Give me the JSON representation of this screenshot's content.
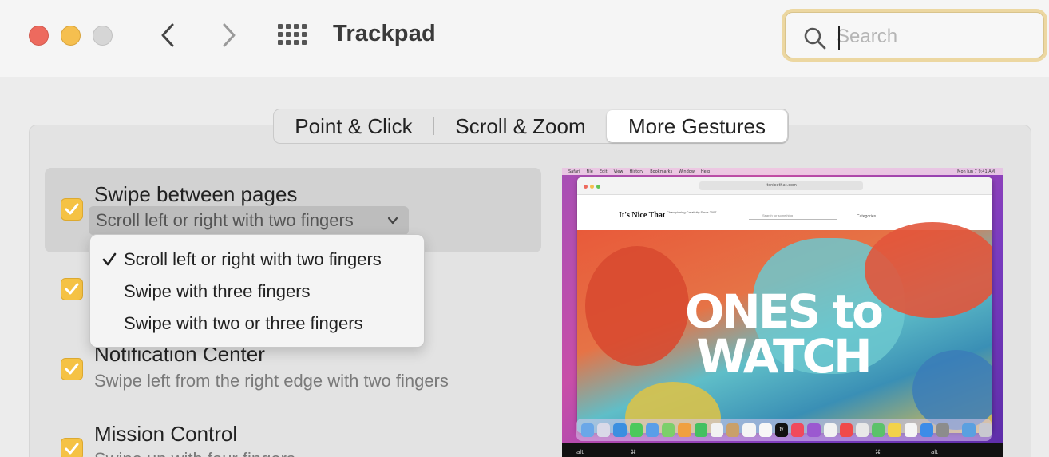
{
  "window": {
    "title": "Trackpad",
    "traffic_lights": {
      "close": "#ed6a5e",
      "minimize": "#f5bf4f",
      "zoom": "#d6d6d6"
    }
  },
  "toolbar": {
    "back_icon": "chevron-left-icon",
    "forward_icon": "chevron-right-icon",
    "grid_icon": "show-all-grid-icon"
  },
  "search": {
    "placeholder": "Search",
    "value": "",
    "focus_ring_color": "#ecd7a1"
  },
  "tabs": [
    {
      "label": "Point & Click",
      "selected": false
    },
    {
      "label": "Scroll & Zoom",
      "selected": false
    },
    {
      "label": "More Gestures",
      "selected": true
    }
  ],
  "options": [
    {
      "title": "Swipe between pages",
      "subtitle": "Scroll left or right with two fingers",
      "checked": true,
      "has_popup": true
    },
    {
      "title": "",
      "subtitle": "",
      "checked": true
    },
    {
      "title": "Notification Center",
      "subtitle": "Swipe left from the right edge with two fingers",
      "checked": true
    },
    {
      "title": "Mission Control",
      "subtitle": "Swipe up with four fingers",
      "checked": true
    }
  ],
  "popup_menu": {
    "items": [
      {
        "label": "Scroll left or right with two fingers",
        "checked": true
      },
      {
        "label": "Swipe with three fingers",
        "checked": false
      },
      {
        "label": "Swipe with two or three fingers",
        "checked": false
      }
    ]
  },
  "accent_color": "#f5c244",
  "preview": {
    "menubar": [
      "Safari",
      "File",
      "Edit",
      "View",
      "History",
      "Bookmarks",
      "Window",
      "Help"
    ],
    "clock": "Mon Jun 7  9:41 AM",
    "url": "itsnicethat.com",
    "site_logo": "It's Nice That",
    "site_tagline": "Championing Creativity Since 2007",
    "site_search_placeholder": "Search for something",
    "site_nav": "Categories",
    "headline_line1": "ONES to",
    "headline_line2": "WATCH",
    "dock_label": "tv",
    "key_alt_left": "alt",
    "key_cmd_left": "⌘",
    "key_cmd_right": "⌘",
    "key_alt_right": "alt"
  }
}
